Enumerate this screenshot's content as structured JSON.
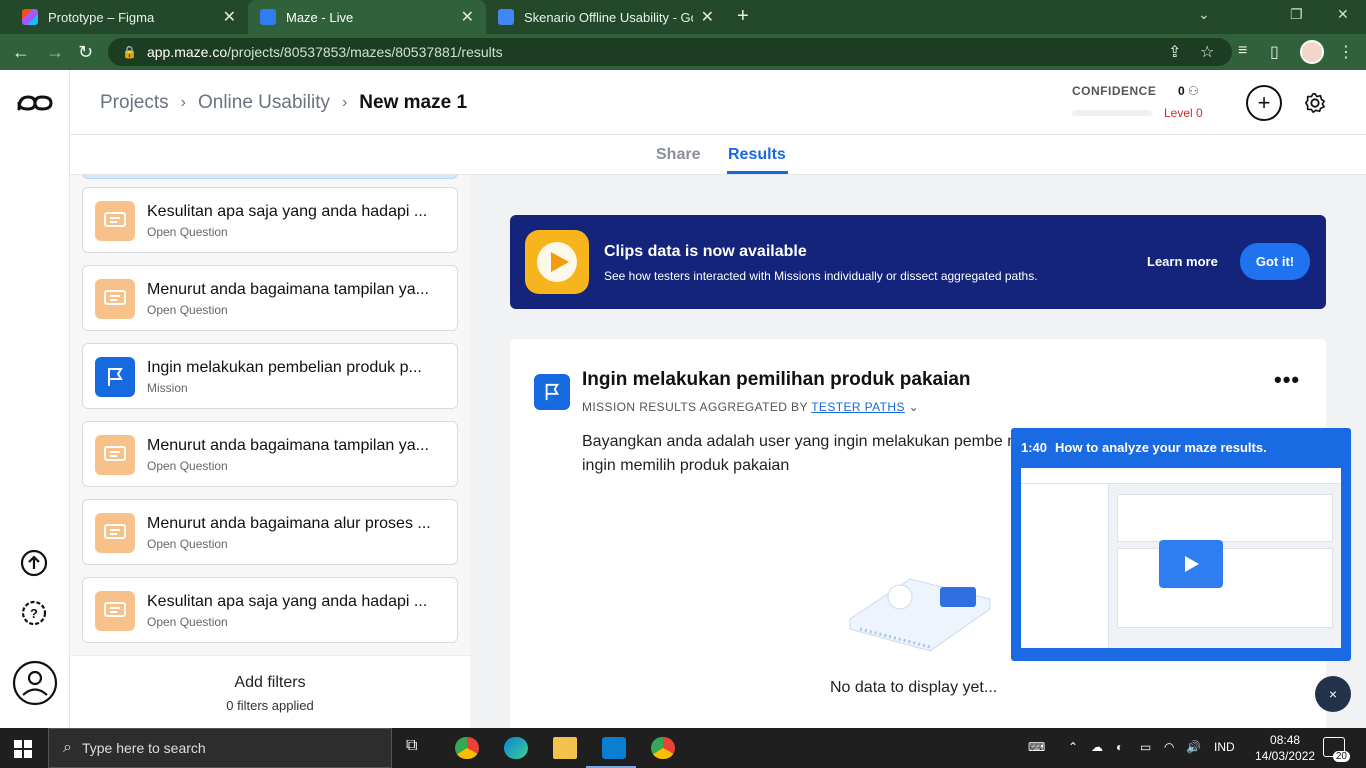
{
  "browser": {
    "tabs": [
      {
        "title": "Prototype – Figma"
      },
      {
        "title": "Maze - Live"
      },
      {
        "title": "Skenario Offline Usability - Goog"
      }
    ],
    "url_host": "app.maze.co",
    "url_path": "/projects/80537853/mazes/80537881/results"
  },
  "header": {
    "breadcrumb": [
      "Projects",
      "Online Usability",
      "New maze 1"
    ],
    "confidence_label": "CONFIDENCE",
    "confidence_count": "0",
    "confidence_level": "Level 0",
    "plus_label": "+"
  },
  "subtabs": [
    "Share",
    "Results"
  ],
  "blocks": [
    {
      "title": "Kesulitan apa saja yang anda hadapi ...",
      "type": "Open Question",
      "kind": "question"
    },
    {
      "title": "Menurut anda bagaimana tampilan ya...",
      "type": "Open Question",
      "kind": "question"
    },
    {
      "title": "Ingin melakukan pembelian produk p...",
      "type": "Mission",
      "kind": "mission"
    },
    {
      "title": "Menurut anda bagaimana tampilan ya...",
      "type": "Open Question",
      "kind": "question"
    },
    {
      "title": "Menurut anda bagaimana alur proses ...",
      "type": "Open Question",
      "kind": "question"
    },
    {
      "title": "Kesulitan apa saja yang anda hadapi ...",
      "type": "Open Question",
      "kind": "question"
    }
  ],
  "filters": {
    "title": "Add filters",
    "applied": "0 filters applied"
  },
  "banner": {
    "title": "Clips data is now available",
    "subtitle": "See how testers interacted with Missions individually or dissect aggregated paths.",
    "learn_more": "Learn more",
    "got_it": "Got it!"
  },
  "mission": {
    "title": "Ingin melakukan pemilihan produk pakaian",
    "aggregated_prefix": "MISSION RESULTS AGGREGATED BY",
    "aggregated_link": "TESTER PATHS",
    "description": "Bayangkan anda adalah user yang ingin melakukan pembe masih ingin memilih produk pakaian",
    "more": "•••",
    "no_data": "No data to display yet..."
  },
  "video": {
    "time": "1:40",
    "title": "How to analyze your maze results.",
    "close": "×"
  },
  "taskbar": {
    "search_placeholder": "Type here to search",
    "lang": "IND",
    "time": "08:48",
    "date": "14/03/2022",
    "notifications": "20"
  },
  "colors": {
    "brand_blue": "#1769e0",
    "banner_bg": "#13247a",
    "question_icon_bg": "#f9c18a",
    "chrome_green": "#31613a"
  }
}
